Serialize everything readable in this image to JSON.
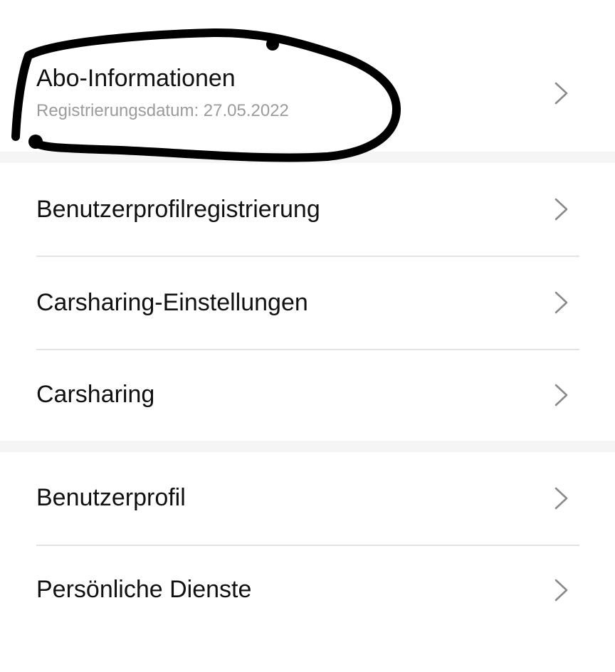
{
  "sections": [
    {
      "items": [
        {
          "label": "Abo-Informationen",
          "subtitle": "Registrierungsdatum: 27.05.2022",
          "icon": "chevron-right-icon"
        }
      ]
    },
    {
      "items": [
        {
          "label": "Benutzerprofilregistrierung",
          "icon": "chevron-right-icon"
        },
        {
          "label": "Carsharing-Einstellungen",
          "icon": "chevron-right-icon"
        },
        {
          "label": "Carsharing",
          "icon": "chevron-right-icon"
        }
      ]
    },
    {
      "items": [
        {
          "label": "Benutzerprofil",
          "icon": "chevron-right-icon"
        },
        {
          "label": "Persönliche Dienste",
          "icon": "chevron-right-icon"
        }
      ]
    }
  ],
  "colors": {
    "text": "#111111",
    "subtitle": "#9b9b9b",
    "chevron": "#8a8a8a",
    "divider": "#e3e3e3",
    "section_gap": "#f5f5f5",
    "annotation_marker": "#000000"
  }
}
